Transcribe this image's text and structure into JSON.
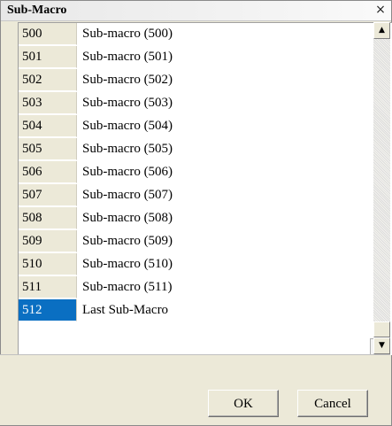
{
  "window": {
    "title": "Sub-Macro",
    "close_label": "×"
  },
  "list": {
    "rows": [
      {
        "num": "500",
        "name": "Sub-macro (500)"
      },
      {
        "num": "501",
        "name": "Sub-macro (501)"
      },
      {
        "num": "502",
        "name": "Sub-macro (502)"
      },
      {
        "num": "503",
        "name": "Sub-macro (503)"
      },
      {
        "num": "504",
        "name": "Sub-macro (504)"
      },
      {
        "num": "505",
        "name": "Sub-macro (505)"
      },
      {
        "num": "506",
        "name": "Sub-macro (506)"
      },
      {
        "num": "507",
        "name": "Sub-macro (507)"
      },
      {
        "num": "508",
        "name": "Sub-macro (508)"
      },
      {
        "num": "509",
        "name": "Sub-macro (509)"
      },
      {
        "num": "510",
        "name": "Sub-macro (510)"
      },
      {
        "num": "511",
        "name": "Sub-macro (511)"
      },
      {
        "num": "512",
        "name": "Last Sub-Macro"
      }
    ],
    "selected": "512"
  },
  "scrollbar": {
    "up_icon": "triangle-up-icon",
    "down_icon": "triangle-down-icon",
    "position_fraction": 1.0
  },
  "buttons": {
    "ok": "OK",
    "cancel": "Cancel"
  },
  "colors": {
    "selection": "#0a6fc2",
    "number_cell_bg": "#ece9d8"
  }
}
